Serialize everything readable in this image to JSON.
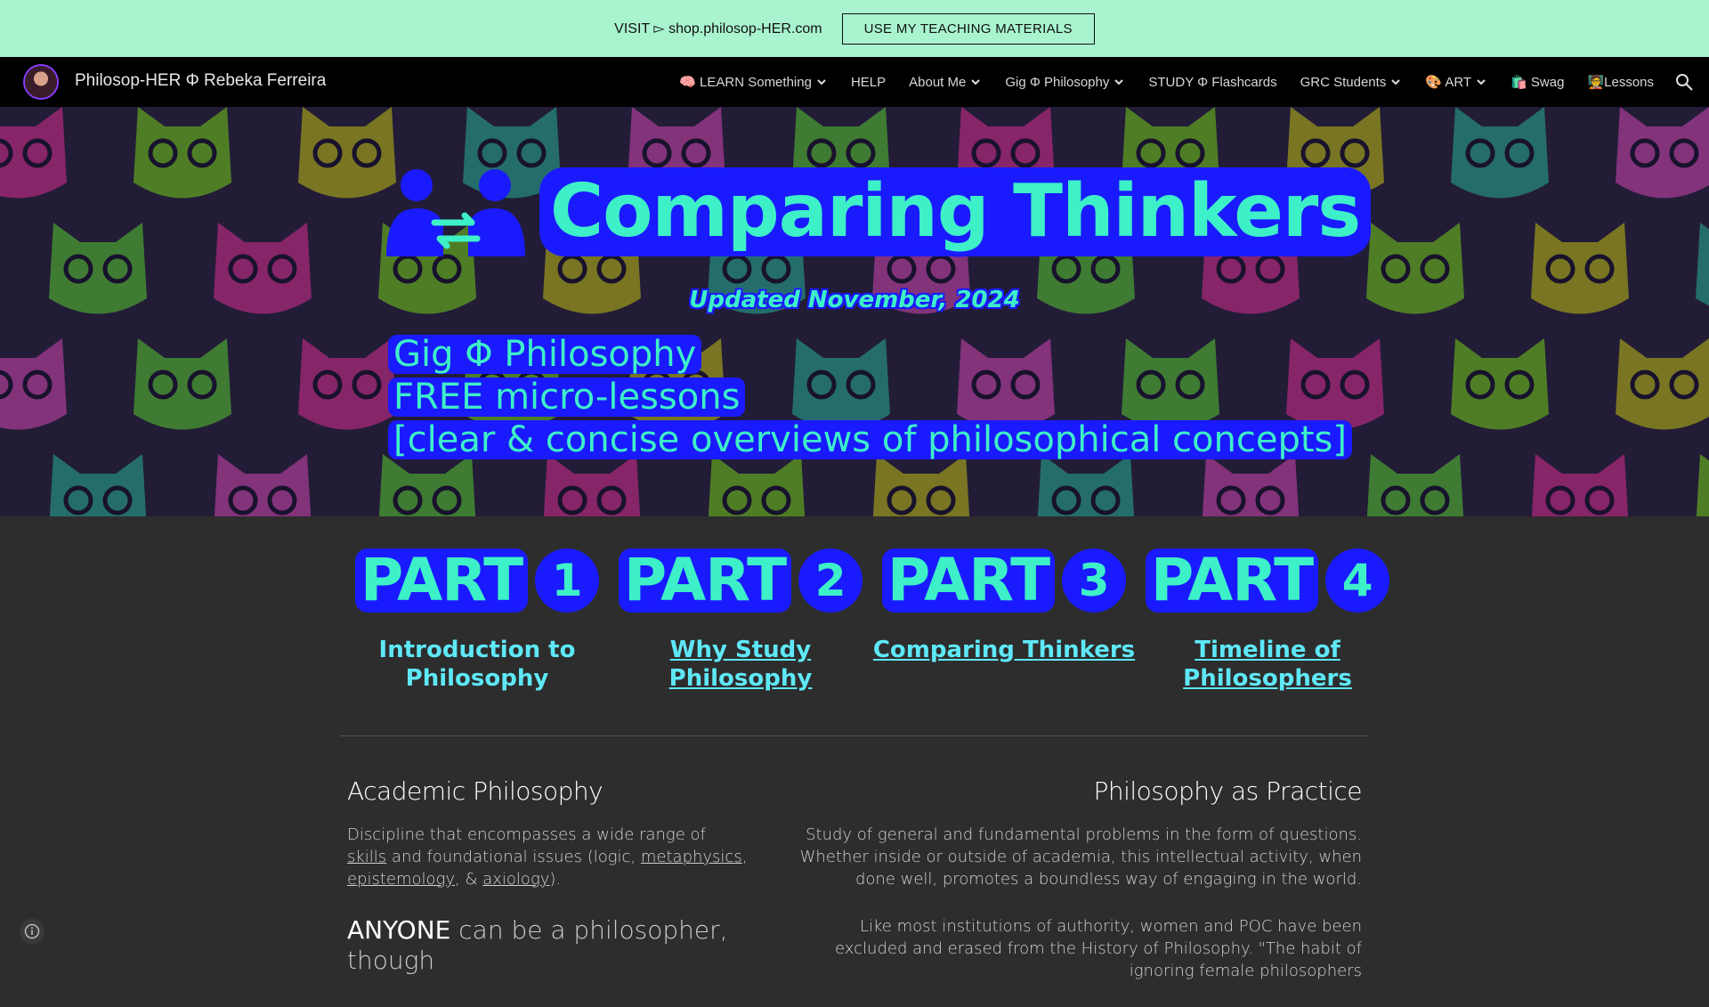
{
  "announcement": {
    "visit_text": "VISIT ▻ shop.philosop-HER.com",
    "button_label": "USE MY TEACHING MATERIALS"
  },
  "nav": {
    "site_title": "Philosop-HER Φ Rebeka Ferreira",
    "items": [
      {
        "label": "🧠 LEARN Something",
        "has_dropdown": true
      },
      {
        "label": "HELP",
        "has_dropdown": false
      },
      {
        "label": "About Me",
        "has_dropdown": true
      },
      {
        "label": "Gig Φ Philosophy",
        "has_dropdown": true
      },
      {
        "label": "STUDY Φ Flashcards",
        "has_dropdown": false
      },
      {
        "label": "GRC Students",
        "has_dropdown": true
      },
      {
        "label": "🎨 ART",
        "has_dropdown": true
      },
      {
        "label": "🛍️ Swag",
        "has_dropdown": false
      },
      {
        "label": "🧑‍🏫Lessons",
        "has_dropdown": false
      }
    ],
    "search_icon": "search-icon"
  },
  "hero": {
    "title": "Comparing Thinkers",
    "updated": "Updated November, 2024",
    "lines": [
      "Gig Φ Philosophy",
      "FREE micro-lessons",
      "[clear & concise overviews of philosophical concepts]"
    ],
    "icon": "people-compare-icon"
  },
  "parts": [
    {
      "word": "PART",
      "num": "1",
      "label": "Introduction to Philosophy",
      "link": false
    },
    {
      "word": "PART",
      "num": "2",
      "label": "Why Study Philosophy",
      "link": true
    },
    {
      "word": "PART",
      "num": "3",
      "label": "Comparing Thinkers",
      "link": true
    },
    {
      "word": "PART",
      "num": "4",
      "label": "Timeline of Philosophers",
      "link": true
    }
  ],
  "academic": {
    "title": "Academic Philosophy",
    "p1_a": "Discipline that encompasses a wide range of ",
    "p1_skills": "skills",
    "p1_b": " and foundational issues (logic, ",
    "p1_meta": "metaphysics",
    "p1_c": ", ",
    "p1_epist": "epistemology",
    "p1_d": ", & ",
    "p1_axio": "axiology",
    "p1_e": ").",
    "anyone_word": "ANYONE",
    "anyone_rest": " can be a philosopher, though"
  },
  "practice": {
    "title": "Philosophy as Practice",
    "p1": "Study of general and fundamental problems in the form of questions. Whether inside or outside of academia, this intellectual activity, when done well, promotes a boundless way of engaging in the world.",
    "p2": "Like most institutions of authority, women and POC have been excluded and erased from the History of Philosophy. \"The habit of ignoring female philosophers"
  },
  "colors": {
    "announce_bg": "#a9f4cf",
    "nav_bg": "#000000",
    "page_bg": "#2d2d2d",
    "accent_mint": "#3df0c8",
    "accent_blue": "#1a1aff",
    "link_cyan": "#5ee8f7"
  }
}
